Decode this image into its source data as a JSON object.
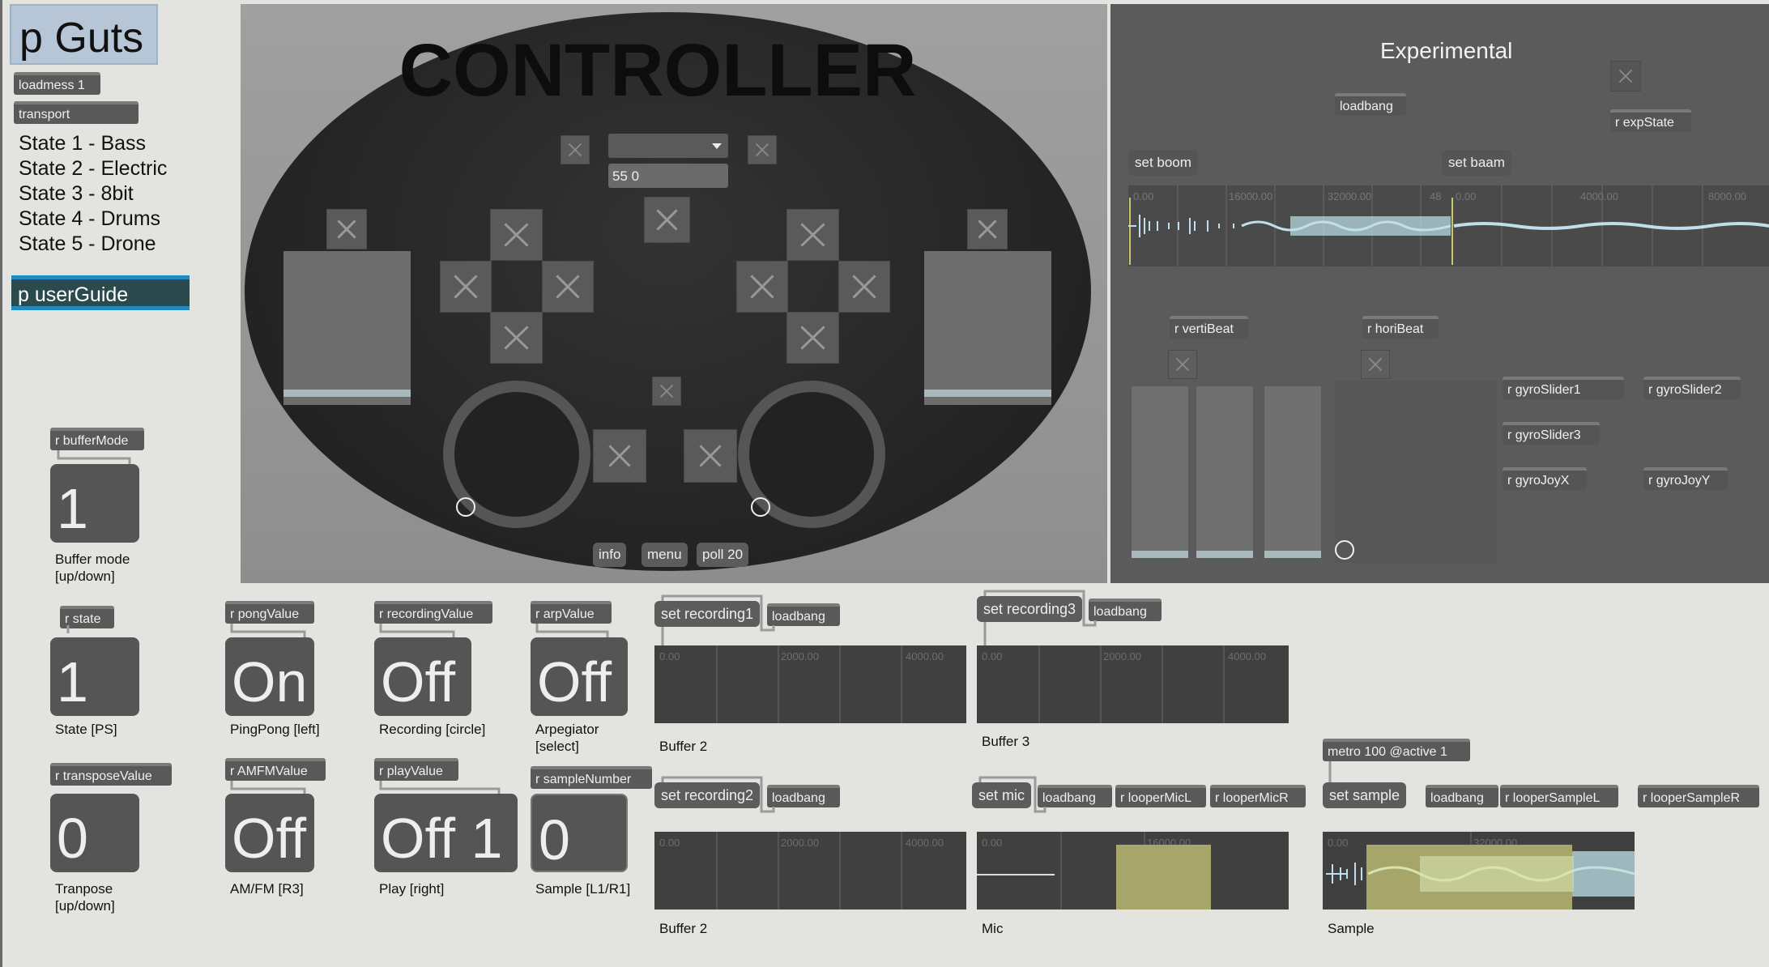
{
  "left": {
    "title": "p Guts",
    "loadmess": "loadmess 1",
    "transport": "transport",
    "states": [
      "State 1 - Bass",
      "State 2 - Electric",
      "State 3 - 8bit",
      "State 4 - Drums",
      "State 5 - Drone"
    ],
    "userguide": "p userGuide",
    "buffermode_recv": "r bufferMode",
    "buffermode_value": "1",
    "buffermode_caption": "Buffer mode [up/down]",
    "state_recv": "r state",
    "state_value": "1",
    "state_caption": "State [PS]",
    "transpose_recv": "r transposeValue",
    "transpose_value": "0",
    "transpose_caption": "Tranpose [up/down]"
  },
  "controls": [
    {
      "recv": "r pongValue",
      "value": "On",
      "caption": "PingPong [left]"
    },
    {
      "recv": "r recordingValue",
      "value": "Off",
      "caption": "Recording [circle]"
    },
    {
      "recv": "r arpValue",
      "value": "Off",
      "caption": "Arpegiator [select]"
    },
    {
      "recv": "r AMFMValue",
      "value": "Off",
      "caption": "AM/FM [R3]"
    },
    {
      "recv": "r playValue",
      "value": "Off 1",
      "caption": "Play [right]"
    },
    {
      "recv": "r sampleNumber",
      "value": "0",
      "caption": "Sample [L1/R1]"
    }
  ],
  "controller": {
    "title": "CONTROLLER",
    "display_value": "55 0",
    "buttons": {
      "info": "info",
      "menu": "menu",
      "poll": "poll 20"
    },
    "left_slider_level": 0.05,
    "right_slider_level": 0.05
  },
  "experimental": {
    "title": "Experimental",
    "loadbang": "loadbang",
    "expstate": "r expState",
    "set_boom": "set boom",
    "set_baam": "set baam",
    "ticks_a": [
      "0.00",
      "16000.00",
      "32000.00",
      "48"
    ],
    "ticks_b": [
      "0.00",
      "4000.00",
      "8000.00"
    ],
    "vertibeat": "r vertiBeat",
    "horibeat": "r horiBeat",
    "gyro1": "r gyroSlider1",
    "gyro2": "r gyroSlider2",
    "gyro3": "r gyroSlider3",
    "joyx": "r gyroJoyX",
    "joyy": "r gyroJoyY"
  },
  "buffers": {
    "rec1": "set recording1",
    "rec2": "set recording2",
    "rec3": "set recording3",
    "loadbang": "loadbang",
    "ticks": [
      "0.00",
      "2000.00",
      "4000.00"
    ],
    "ticks_mic": [
      "0.00",
      "16000.00"
    ],
    "ticks_sample": [
      "0.00",
      "32000.00"
    ],
    "label_buffer2a": "Buffer 2",
    "label_buffer3": "Buffer 3",
    "label_buffer2b": "Buffer 2",
    "label_mic": "Mic",
    "label_sample": "Sample",
    "metro": "metro 100 @active 1",
    "set_mic": "set mic",
    "looper_mic_l": "r looperMicL",
    "looper_mic_r": "r looperMicR",
    "set_sample": "set sample",
    "looper_sample_l": "r looperSampleL",
    "looper_sample_r": "r looperSampleR"
  },
  "colors": {
    "background": "#e3e3df",
    "controller_panel": "#9a9a9a",
    "controller_body": "#2a2a2a",
    "experimental_panel": "#5b5b5b",
    "waveform": "#bfe0ea",
    "selection": "#a6a66a",
    "userguide_accent": "#1f8bc0"
  }
}
